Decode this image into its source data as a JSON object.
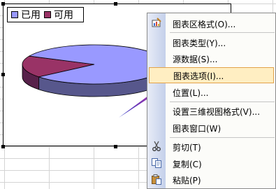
{
  "legend": {
    "items": [
      {
        "label": "已用",
        "color": "#9999ff"
      },
      {
        "label": "可用",
        "color": "#993366"
      }
    ]
  },
  "chart_data": {
    "type": "pie",
    "labels": [
      "已用",
      "可用"
    ],
    "values": [
      82,
      18
    ],
    "colors": [
      "#9999ff",
      "#993366"
    ],
    "side_colors": [
      "#57578c",
      "#57214a"
    ],
    "three_d": true
  },
  "context_menu": {
    "items": [
      {
        "label": "图表区格式(O)...",
        "icon": "chart-area-format-icon",
        "highlighted": false
      },
      {
        "label": "图表类型(Y)...",
        "icon": "",
        "highlighted": false
      },
      {
        "label": "源数据(S)...",
        "icon": "",
        "highlighted": false
      },
      {
        "label": "图表选项(I)...",
        "icon": "",
        "highlighted": true
      },
      {
        "label": "位置(L)...",
        "icon": "",
        "highlighted": false
      },
      {
        "label": "设置三维视图格式(V)...",
        "icon": "",
        "highlighted": false
      },
      {
        "label": "图表窗口(W)",
        "icon": "",
        "highlighted": false
      },
      {
        "label": "剪切(T)",
        "icon": "scissors-icon",
        "highlighted": false
      },
      {
        "label": "复制(C)",
        "icon": "copy-icon",
        "highlighted": false
      },
      {
        "label": "粘贴(P)",
        "icon": "paste-icon",
        "highlighted": false
      }
    ]
  },
  "annotation": {
    "arrow_color": "#cc33cc"
  }
}
